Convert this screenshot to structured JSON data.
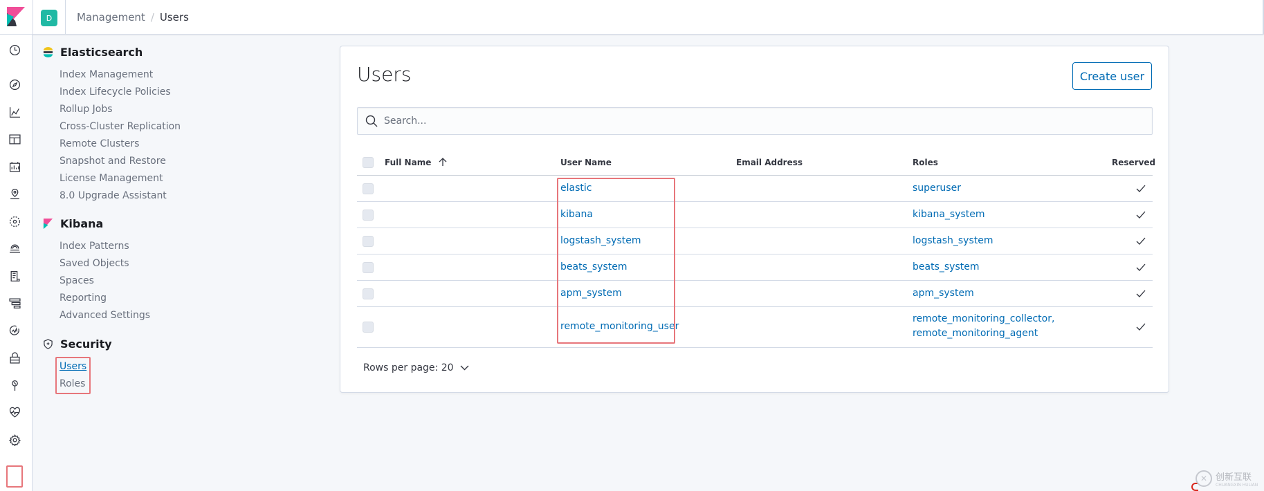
{
  "header": {
    "space_initial": "D",
    "breadcrumb": {
      "parent": "Management",
      "separator": "/",
      "current": "Users"
    }
  },
  "rail": {
    "icons": [
      "clock-icon",
      "compass-icon",
      "visualize-icon",
      "dashboard-icon",
      "canvas-icon",
      "maps-icon",
      "ml-icon",
      "infrastructure-icon",
      "logs-icon",
      "apm-icon",
      "uptime-icon",
      "siem-icon",
      "dev-tools-icon",
      "monitoring-icon",
      "management-icon"
    ]
  },
  "sidenav": {
    "sections": [
      {
        "title": "Elasticsearch",
        "items": [
          "Index Management",
          "Index Lifecycle Policies",
          "Rollup Jobs",
          "Cross-Cluster Replication",
          "Remote Clusters",
          "Snapshot and Restore",
          "License Management",
          "8.0 Upgrade Assistant"
        ]
      },
      {
        "title": "Kibana",
        "items": [
          "Index Patterns",
          "Saved Objects",
          "Spaces",
          "Reporting",
          "Advanced Settings"
        ]
      },
      {
        "title": "Security",
        "items": [
          "Users",
          "Roles"
        ],
        "active": "Users"
      }
    ]
  },
  "main": {
    "title": "Users",
    "create_button": "Create user",
    "search_placeholder": "Search...",
    "columns": [
      "Full Name",
      "User Name",
      "Email Address",
      "Roles",
      "Reserved"
    ],
    "sort_column": "Full Name",
    "sort_direction": "ascending",
    "rows": [
      {
        "full_name": "",
        "user_name": "elastic",
        "email": "",
        "roles": [
          "superuser"
        ],
        "reserved": true
      },
      {
        "full_name": "",
        "user_name": "kibana",
        "email": "",
        "roles": [
          "kibana_system"
        ],
        "reserved": true
      },
      {
        "full_name": "",
        "user_name": "logstash_system",
        "email": "",
        "roles": [
          "logstash_system"
        ],
        "reserved": true
      },
      {
        "full_name": "",
        "user_name": "beats_system",
        "email": "",
        "roles": [
          "beats_system"
        ],
        "reserved": true
      },
      {
        "full_name": "",
        "user_name": "apm_system",
        "email": "",
        "roles": [
          "apm_system"
        ],
        "reserved": true
      },
      {
        "full_name": "",
        "user_name": "remote_monitoring_user",
        "email": "",
        "roles": [
          "remote_monitoring_collector,",
          "remote_monitoring_agent"
        ],
        "reserved": true
      }
    ],
    "rows_per_page_label": "Rows per page: 20"
  },
  "watermark": {
    "text": "创新互联",
    "subtext": "CHUANGXIN HULIAN"
  },
  "colors": {
    "accent": "#006bb4",
    "highlight": "#e7767b",
    "space_avatar": "#20b9a4"
  }
}
